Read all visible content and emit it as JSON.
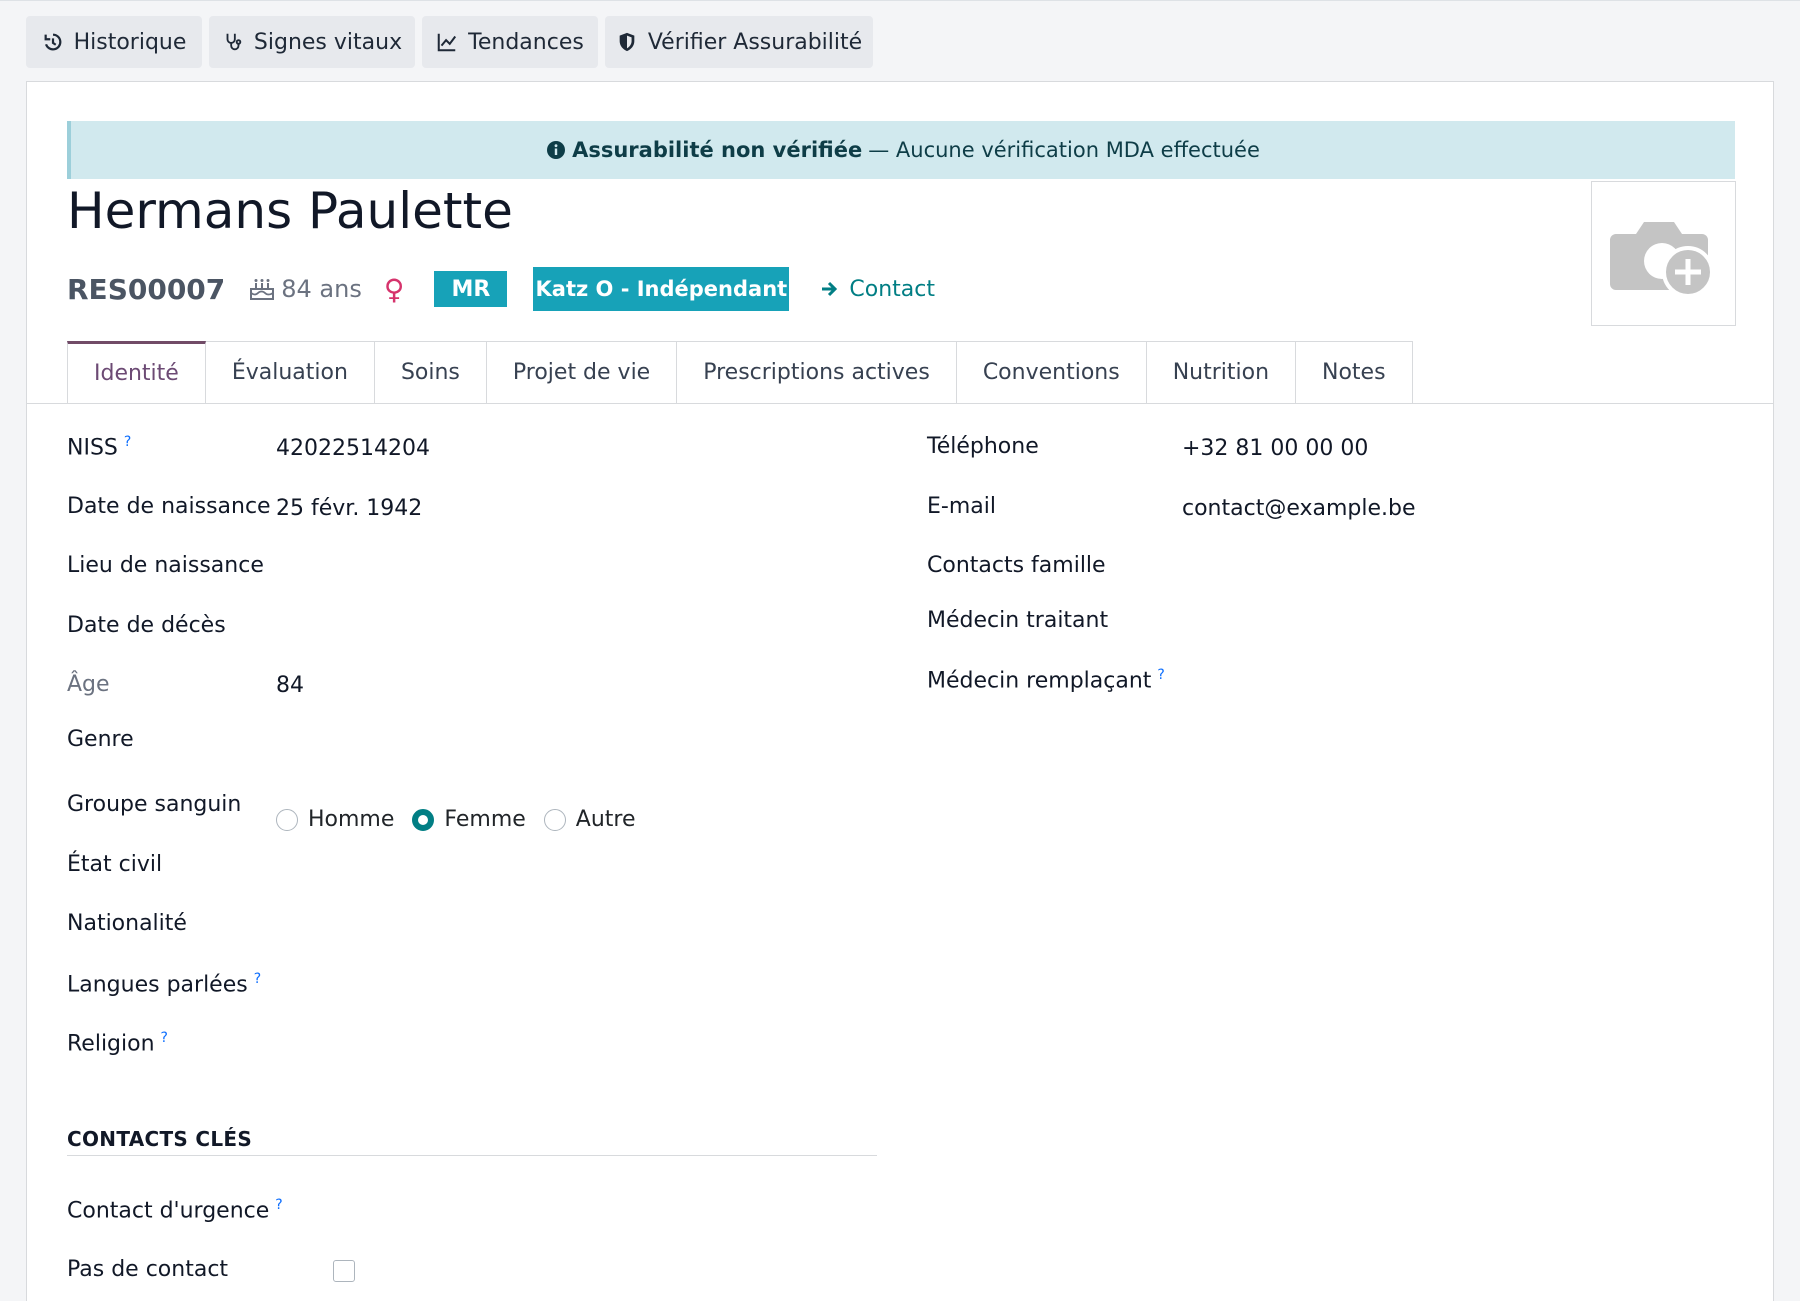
{
  "toolbar": {
    "history": "Historique",
    "vitals": "Signes vitaux",
    "trends": "Tendances",
    "verify": "Vérifier Assurabilité"
  },
  "alert": {
    "strong": "Assurabilité non vérifiée",
    "rest": "— Aucune vérification MDA effectuée"
  },
  "patient": {
    "name": "Hermans Paulette",
    "ref": "RES00007",
    "age_text": "84 ans",
    "gender_symbol": "♀",
    "badge_mr": "MR",
    "badge_katz": "Katz O - Indépendant",
    "contact_link": "Contact"
  },
  "tabs": [
    "Identité",
    "Évaluation",
    "Soins",
    "Projet de vie",
    "Prescriptions actives",
    "Conventions",
    "Nutrition",
    "Notes"
  ],
  "left_fields": {
    "niss_label": "NISS",
    "niss_value": "42022514204",
    "dob_label": "Date de naissance",
    "dob_value": "25 févr. 1942",
    "pob_label": "Lieu de naissance",
    "dod_label": "Date de décès",
    "age_label": "Âge",
    "age_value": "84",
    "gender_label": "Genre",
    "gender_options": [
      "Homme",
      "Femme",
      "Autre"
    ],
    "blood_label": "Groupe sanguin",
    "civil_label": "État civil",
    "nationality_label": "Nationalité",
    "languages_label": "Langues parlées",
    "religion_label": "Religion"
  },
  "right_fields": {
    "phone_label": "Téléphone",
    "phone_value": "+32 81 00 00 00",
    "email_label": "E-mail",
    "email_value": "contact@example.be",
    "family_label": "Contacts famille",
    "doctor_label": "Médecin traitant",
    "replacement_label": "Médecin remplaçant"
  },
  "key_contacts": {
    "title": "CONTACTS CLÉS",
    "emergency_label": "Contact d'urgence",
    "no_contact_label": "Pas de contact"
  },
  "help_mark": "?",
  "colors": {
    "accent": "#017e84",
    "badge": "#17a2b8",
    "tab_active": "#714b67",
    "alert_bg": "#d1e9ee"
  }
}
